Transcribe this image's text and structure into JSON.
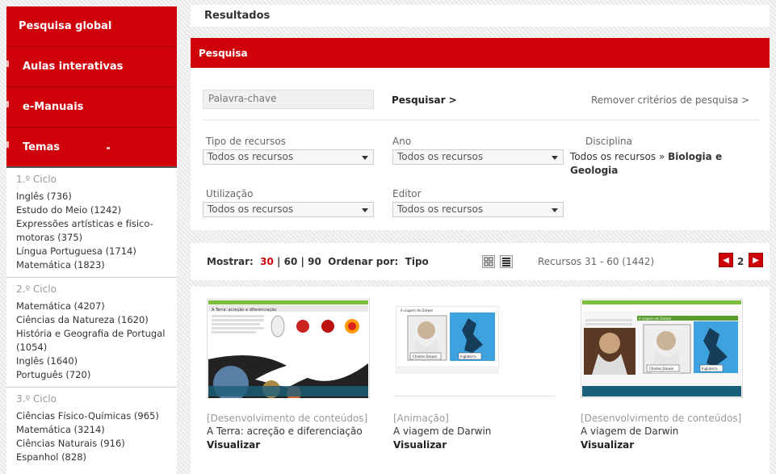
{
  "sidebar": {
    "nav": [
      {
        "label": "Pesquisa global"
      },
      {
        "label": "Aulas interativas"
      },
      {
        "label": "e-Manuais"
      },
      {
        "label": "Temas"
      }
    ],
    "cycles": [
      {
        "title": "1.º Ciclo",
        "items": [
          "Inglês (736)",
          "Estudo do Meio (1242)",
          "Expressões artísticas e físico-motoras (375)",
          "Língua Portuguesa (1714)",
          "Matemática (1823)"
        ]
      },
      {
        "title": "2.º Ciclo",
        "items": [
          "Matemática (4207)",
          "Ciências da Natureza (1620)",
          "História e Geografia de Portugal (1054)",
          "Inglês (1640)",
          "Português (720)"
        ]
      },
      {
        "title": "3.º Ciclo",
        "items": [
          "Ciências Físico-Químicas (965)",
          "Matemática (3214)",
          "Ciências Naturais (916)",
          "Espanhol (828)"
        ]
      }
    ]
  },
  "header": {
    "results_title": "Resultados"
  },
  "search": {
    "title": "Pesquisa",
    "keyword_placeholder": "Palavra-chave",
    "search_button": "Pesquisar >",
    "remove_link": "Remover critérios de pesquisa >",
    "tipo_label": "Tipo de recursos",
    "tipo_value": "Todos os recursos",
    "ano_label": "Ano",
    "ano_value": "Todos os recursos",
    "disciplina_label": "Disciplina",
    "disciplina_prefix": "Todos os recursos",
    "disciplina_sep": "»",
    "disciplina_value": "Biologia e Geologia",
    "utilizacao_label": "Utilização",
    "utilizacao_value": "Todos os recursos",
    "editor_label": "Editor",
    "editor_value": "Todos os recursos"
  },
  "toolbar": {
    "show_label": "Mostrar:",
    "show_options": [
      "30",
      "60",
      "90"
    ],
    "separator": "|",
    "order_label": "Ordenar por:",
    "order_value": "Tipo",
    "count_label": "Recursos 31 - 60 (1442)",
    "current_page": "2",
    "prev_glyph": "◀",
    "next_glyph": "▶"
  },
  "results": [
    {
      "meta": "[Desenvolvimento de conteúdos]",
      "title": "A Terra: acreção e diferenciação",
      "action": "Visualizar",
      "thumb_heading": "A Terra: acreção e diferenciação"
    },
    {
      "meta": "[Animação]",
      "title": "A viagem de Darwin",
      "action": "Visualizar",
      "thumb_heading": "A viagem de Darwin",
      "thumb_labels": [
        "Charles Darwin",
        "Inglaterra"
      ]
    },
    {
      "meta": "[Desenvolvimento de conteúdos]",
      "title": "A viagem de Darwin",
      "action": "Visualizar",
      "thumb_heading": "A viagem de Darwin",
      "thumb_labels": [
        "Charles Darwin",
        "Inglaterra"
      ]
    }
  ],
  "colors": {
    "brand_red": "#d0000b",
    "active_option": "#d0000b",
    "muted_text": "#999999"
  }
}
